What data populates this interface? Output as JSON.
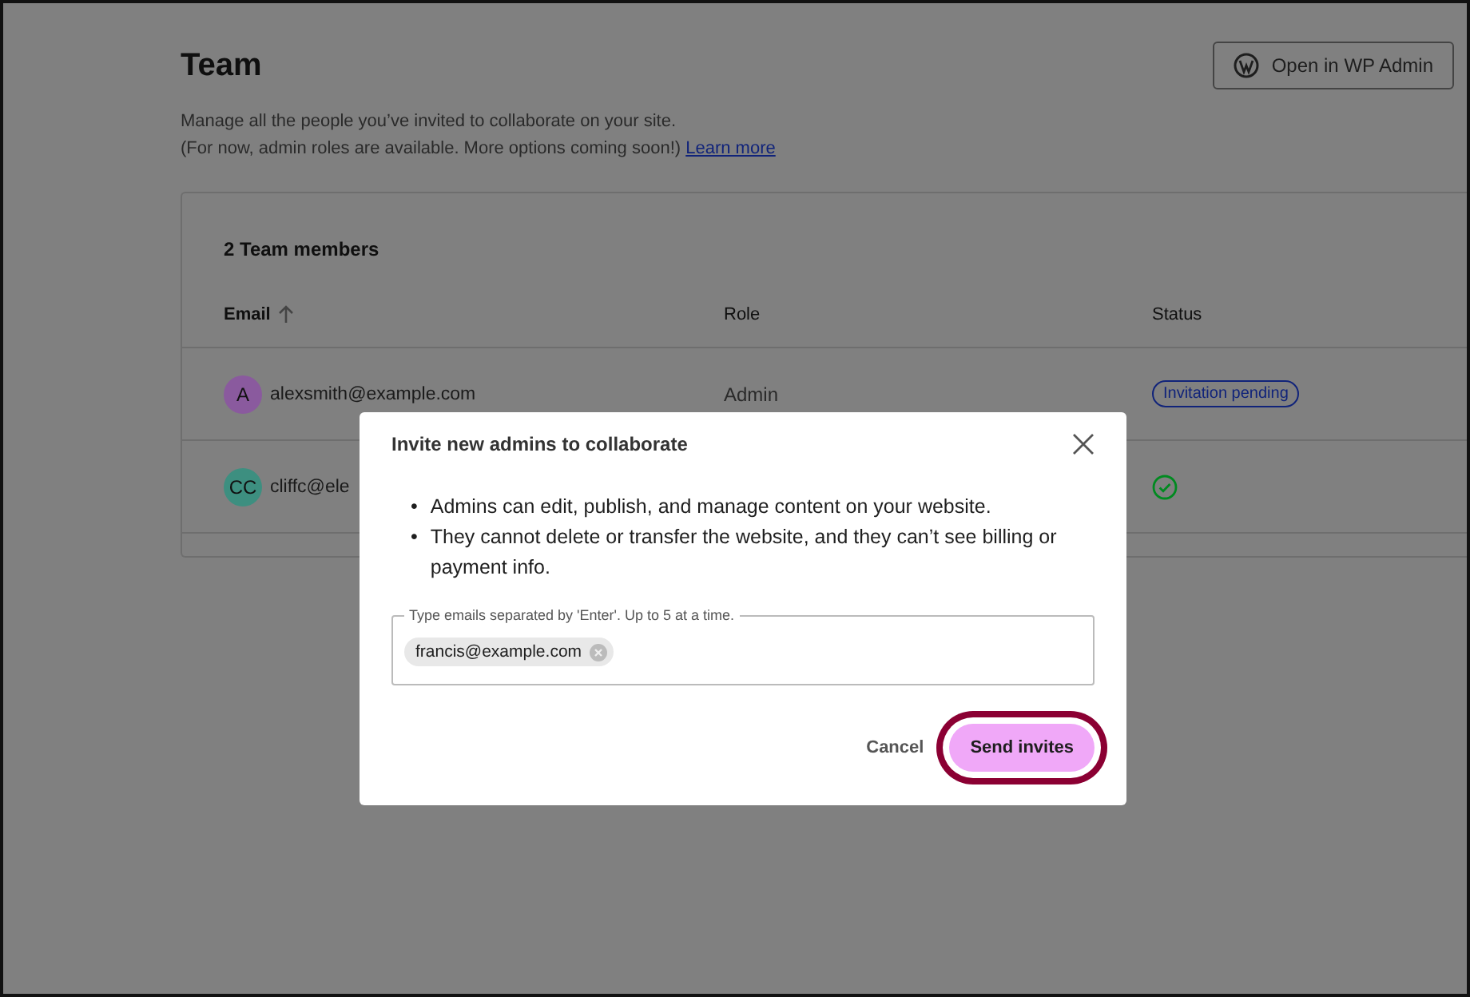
{
  "page": {
    "title": "Team",
    "description": "Manage all the people you’ve invited to collaborate on your site.",
    "note": "(For now, admin roles are available. More options coming soon!)",
    "link": "Learn more",
    "admin_button": "Open in WP Admin"
  },
  "members": {
    "count_label": "2 Team members",
    "columns": [
      {
        "label": "Email",
        "sorted": true
      },
      {
        "label": "Role",
        "sorted": false
      },
      {
        "label": "Status",
        "sorted": false
      }
    ],
    "rows": [
      {
        "initials": "A",
        "color": "#8a5a9e",
        "email": "alexsmith@example.com",
        "role": "Admin",
        "status": {
          "kind": "badge",
          "label": "Invitation pending"
        }
      },
      {
        "initials": "CC",
        "color": "#3d8f80",
        "email": "cliffc@ele",
        "status": {
          "kind": "check"
        }
      }
    ]
  },
  "dialog": {
    "title": "Invite new admins to collaborate",
    "bullets": [
      {
        "marker": "•",
        "text": "Admins can edit, publish, and manage content on your website."
      },
      {
        "marker": "•",
        "text": "They cannot delete or transfer the website, and they can’t see billing or payment info."
      }
    ],
    "field_label": "Type emails separated by 'Enter'. Up to 5 at a time.",
    "chips": [
      "francis@example.com"
    ],
    "buttons": [
      {
        "kind": "secondary",
        "label": "Cancel",
        "highlighted": false
      },
      {
        "kind": "primary",
        "label": "Send invites",
        "highlighted": true
      }
    ]
  }
}
